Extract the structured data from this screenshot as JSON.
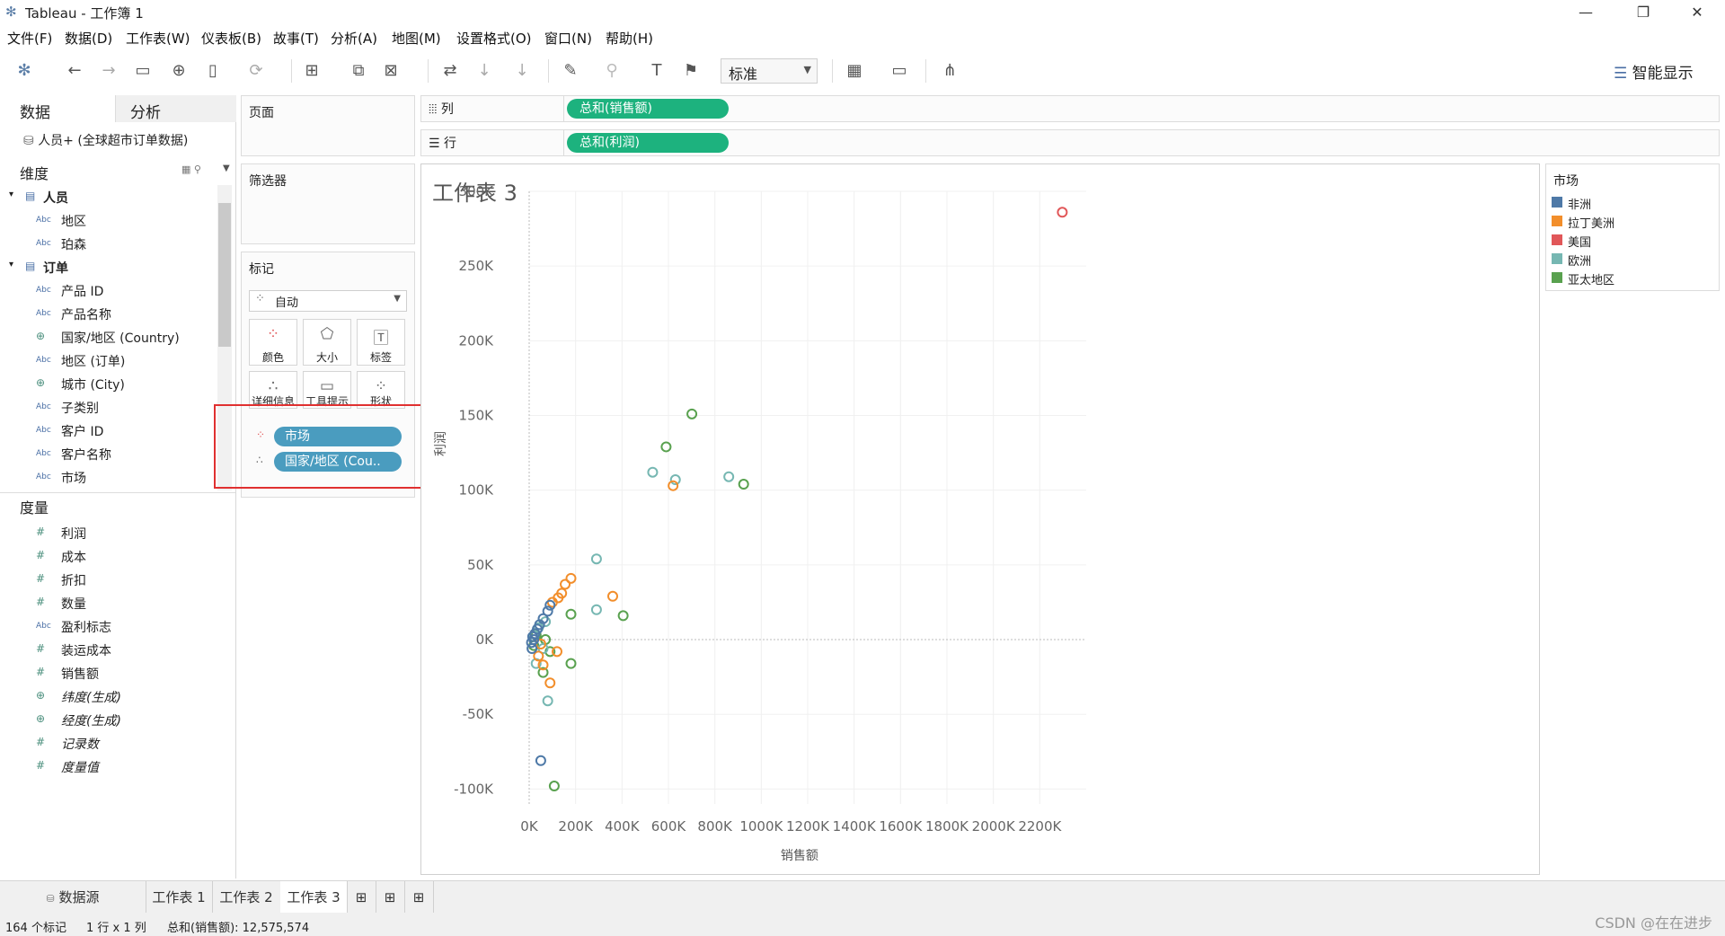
{
  "window": {
    "title": "Tableau - 工作簿 1",
    "minimize": "—",
    "restore": "❐",
    "close": "✕"
  },
  "menu": [
    "文件(F)",
    "数据(D)",
    "工作表(W)",
    "仪表板(B)",
    "故事(T)",
    "分析(A)",
    "地图(M)",
    "设置格式(O)",
    "窗口(N)",
    "帮助(H)"
  ],
  "toolbar": {
    "fit_value": "标准",
    "smart_show": "智能显示"
  },
  "data_pane": {
    "tab_data": "数据",
    "tab_analysis": "分析",
    "datasource": "人员+ (全球超市订单数据)",
    "dimensions_label": "维度",
    "measures_label": "度量",
    "dimensions": [
      {
        "label": "人员",
        "type": "folder"
      },
      {
        "label": "地区",
        "type": "abc"
      },
      {
        "label": "珀森",
        "type": "abc"
      },
      {
        "label": "订单",
        "type": "folder"
      },
      {
        "label": "产品 ID",
        "type": "abc"
      },
      {
        "label": "产品名称",
        "type": "abc"
      },
      {
        "label": "国家/地区 (Country)",
        "type": "geo"
      },
      {
        "label": "地区 (订单)",
        "type": "abc"
      },
      {
        "label": "城市 (City)",
        "type": "geo"
      },
      {
        "label": "子类别",
        "type": "abc"
      },
      {
        "label": "客户 ID",
        "type": "abc"
      },
      {
        "label": "客户名称",
        "type": "abc"
      },
      {
        "label": "市场",
        "type": "abc"
      }
    ],
    "measures": [
      {
        "label": "利润",
        "type": "num"
      },
      {
        "label": "成本",
        "type": "num"
      },
      {
        "label": "折扣",
        "type": "num"
      },
      {
        "label": "数量",
        "type": "num"
      },
      {
        "label": "盈利标志",
        "type": "abc"
      },
      {
        "label": "装运成本",
        "type": "num"
      },
      {
        "label": "销售额",
        "type": "num"
      },
      {
        "label": "纬度(生成)",
        "type": "geo"
      },
      {
        "label": "经度(生成)",
        "type": "geo"
      },
      {
        "label": "记录数",
        "type": "num"
      },
      {
        "label": "度量值",
        "type": "num"
      }
    ]
  },
  "shelves": {
    "pages_label": "页面",
    "filters_label": "筛选器",
    "marks_label": "标记",
    "mark_type": "自动",
    "mark_buttons": [
      "颜色",
      "大小",
      "标签",
      "详细信息",
      "工具提示",
      "形状"
    ],
    "mark_pills": [
      "市场",
      "国家/地区 (Cou.."
    ],
    "columns_label": "列",
    "rows_label": "行",
    "columns_pill": "总和(销售额)",
    "rows_pill": "总和(利润)"
  },
  "view": {
    "title": "工作表 3"
  },
  "legend": {
    "title": "市场",
    "items": [
      {
        "label": "非洲",
        "color": "#4e79a7"
      },
      {
        "label": "拉丁美洲",
        "color": "#f28e2b"
      },
      {
        "label": "美国",
        "color": "#e15759"
      },
      {
        "label": "欧洲",
        "color": "#76b7b2"
      },
      {
        "label": "亚太地区",
        "color": "#59a14f"
      }
    ]
  },
  "chart_data": {
    "type": "scatter",
    "xlabel": "销售额",
    "ylabel": "利润",
    "xlim": [
      0,
      2400000
    ],
    "ylim": [
      -110000,
      300000
    ],
    "x_ticks": [
      "0K",
      "200K",
      "400K",
      "600K",
      "800K",
      "1000K",
      "1200K",
      "1400K",
      "1600K",
      "1800K",
      "2000K",
      "2200K"
    ],
    "y_ticks": [
      "300K",
      "250K",
      "200K",
      "150K",
      "100K",
      "50K",
      "0K",
      "-50K",
      "-100K"
    ],
    "series": [
      {
        "name": "美国",
        "color": "#e15759",
        "points": [
          [
            2297000,
            286000
          ]
        ]
      },
      {
        "name": "亚太地区",
        "color": "#59a14f",
        "points": [
          [
            701000,
            151000
          ],
          [
            590000,
            129000
          ],
          [
            924000,
            104000
          ],
          [
            405000,
            16000
          ],
          [
            180000,
            17000
          ],
          [
            70000,
            0
          ],
          [
            90000,
            -8000
          ],
          [
            180000,
            -16000
          ],
          [
            60000,
            -22000
          ],
          [
            108000,
            -98000
          ],
          [
            30000,
            3000
          ],
          [
            20000,
            -4000
          ]
        ]
      },
      {
        "name": "欧洲",
        "color": "#76b7b2",
        "points": [
          [
            532000,
            112000
          ],
          [
            630000,
            107000
          ],
          [
            860000,
            109000
          ],
          [
            290000,
            54000
          ],
          [
            290000,
            20000
          ],
          [
            80000,
            -41000
          ],
          [
            30000,
            -16000
          ],
          [
            60000,
            -6000
          ],
          [
            40000,
            8000
          ],
          [
            70000,
            12000
          ],
          [
            20000,
            2000
          ]
        ]
      },
      {
        "name": "拉丁美洲",
        "color": "#f28e2b",
        "points": [
          [
            620000,
            103000
          ],
          [
            180000,
            41000
          ],
          [
            155000,
            37000
          ],
          [
            140000,
            31000
          ],
          [
            125000,
            28000
          ],
          [
            360000,
            29000
          ],
          [
            120000,
            -8000
          ],
          [
            90000,
            -29000
          ],
          [
            60000,
            -17000
          ],
          [
            40000,
            -11000
          ],
          [
            100000,
            25000
          ],
          [
            50000,
            -3000
          ]
        ]
      },
      {
        "name": "非洲",
        "color": "#4e79a7",
        "points": [
          [
            50000,
            -81000
          ],
          [
            90000,
            23000
          ],
          [
            80000,
            19000
          ],
          [
            60000,
            14000
          ],
          [
            45000,
            10000
          ],
          [
            35000,
            7000
          ],
          [
            25000,
            4000
          ],
          [
            15000,
            2000
          ],
          [
            10000,
            -2000
          ],
          [
            12000,
            -6000
          ],
          [
            20000,
            0
          ]
        ]
      }
    ]
  },
  "sheet_tabs": {
    "datasource": "数据源",
    "sheets": [
      "工作表 1",
      "工作表 2",
      "工作表 3"
    ]
  },
  "status": {
    "marks": "164 个标记",
    "rows_cols": "1 行 x 1 列",
    "sum": "总和(销售额): 12,575,574"
  },
  "watermark": "CSDN @在在进步"
}
